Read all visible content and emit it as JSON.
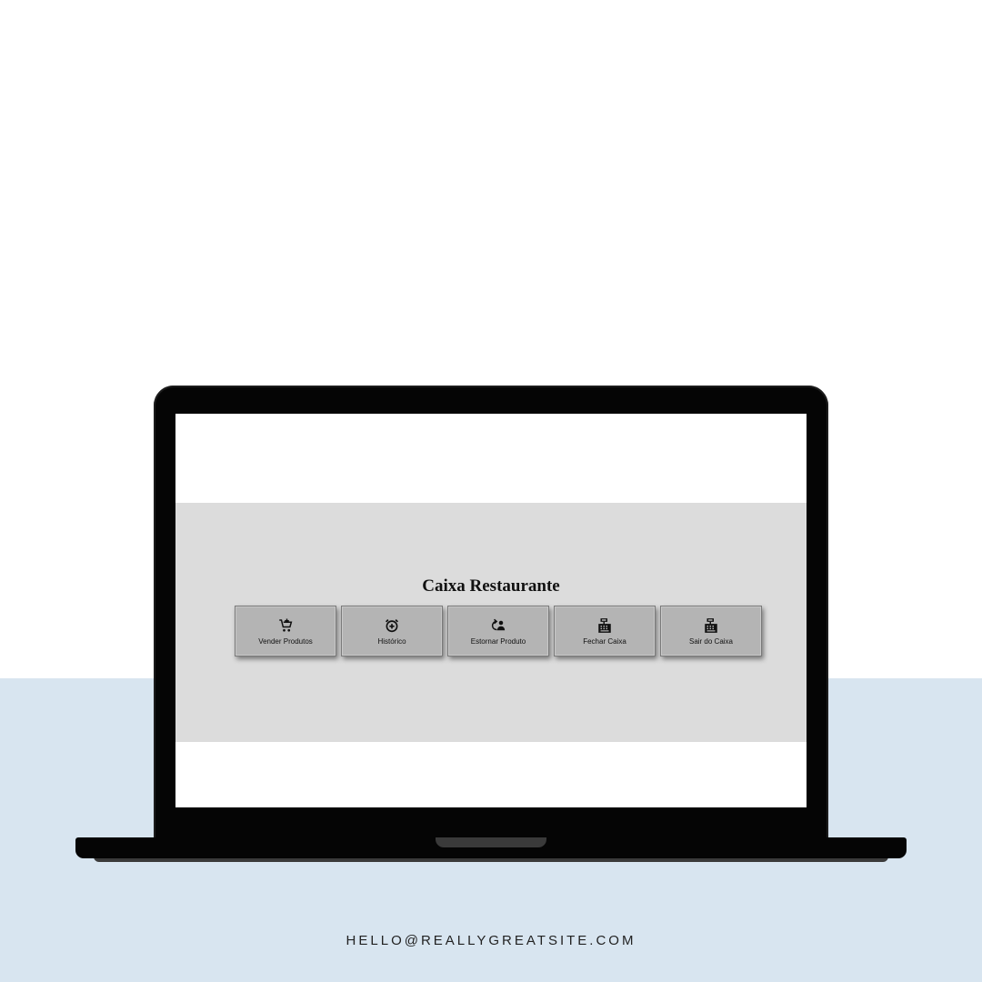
{
  "app": {
    "title": "Caixa Restaurante",
    "buttons": [
      {
        "label": "Vender Produtos",
        "icon": "cart-plus-icon"
      },
      {
        "label": "Histórico",
        "icon": "alarm-clock-icon"
      },
      {
        "label": "Estornar Produto",
        "icon": "refund-user-icon"
      },
      {
        "label": "Fechar Caixa",
        "icon": "cash-register-icon"
      },
      {
        "label": "Sair do Caixa",
        "icon": "cash-register-icon"
      }
    ]
  },
  "footer": {
    "email": "HELLO@REALLYGREATSITE.COM"
  },
  "colors": {
    "backdrop_bottom": "#d8e5f0",
    "laptop_frame": "#050505",
    "app_panel": "#dcdcdc",
    "button_face": "#b4b4b4"
  }
}
